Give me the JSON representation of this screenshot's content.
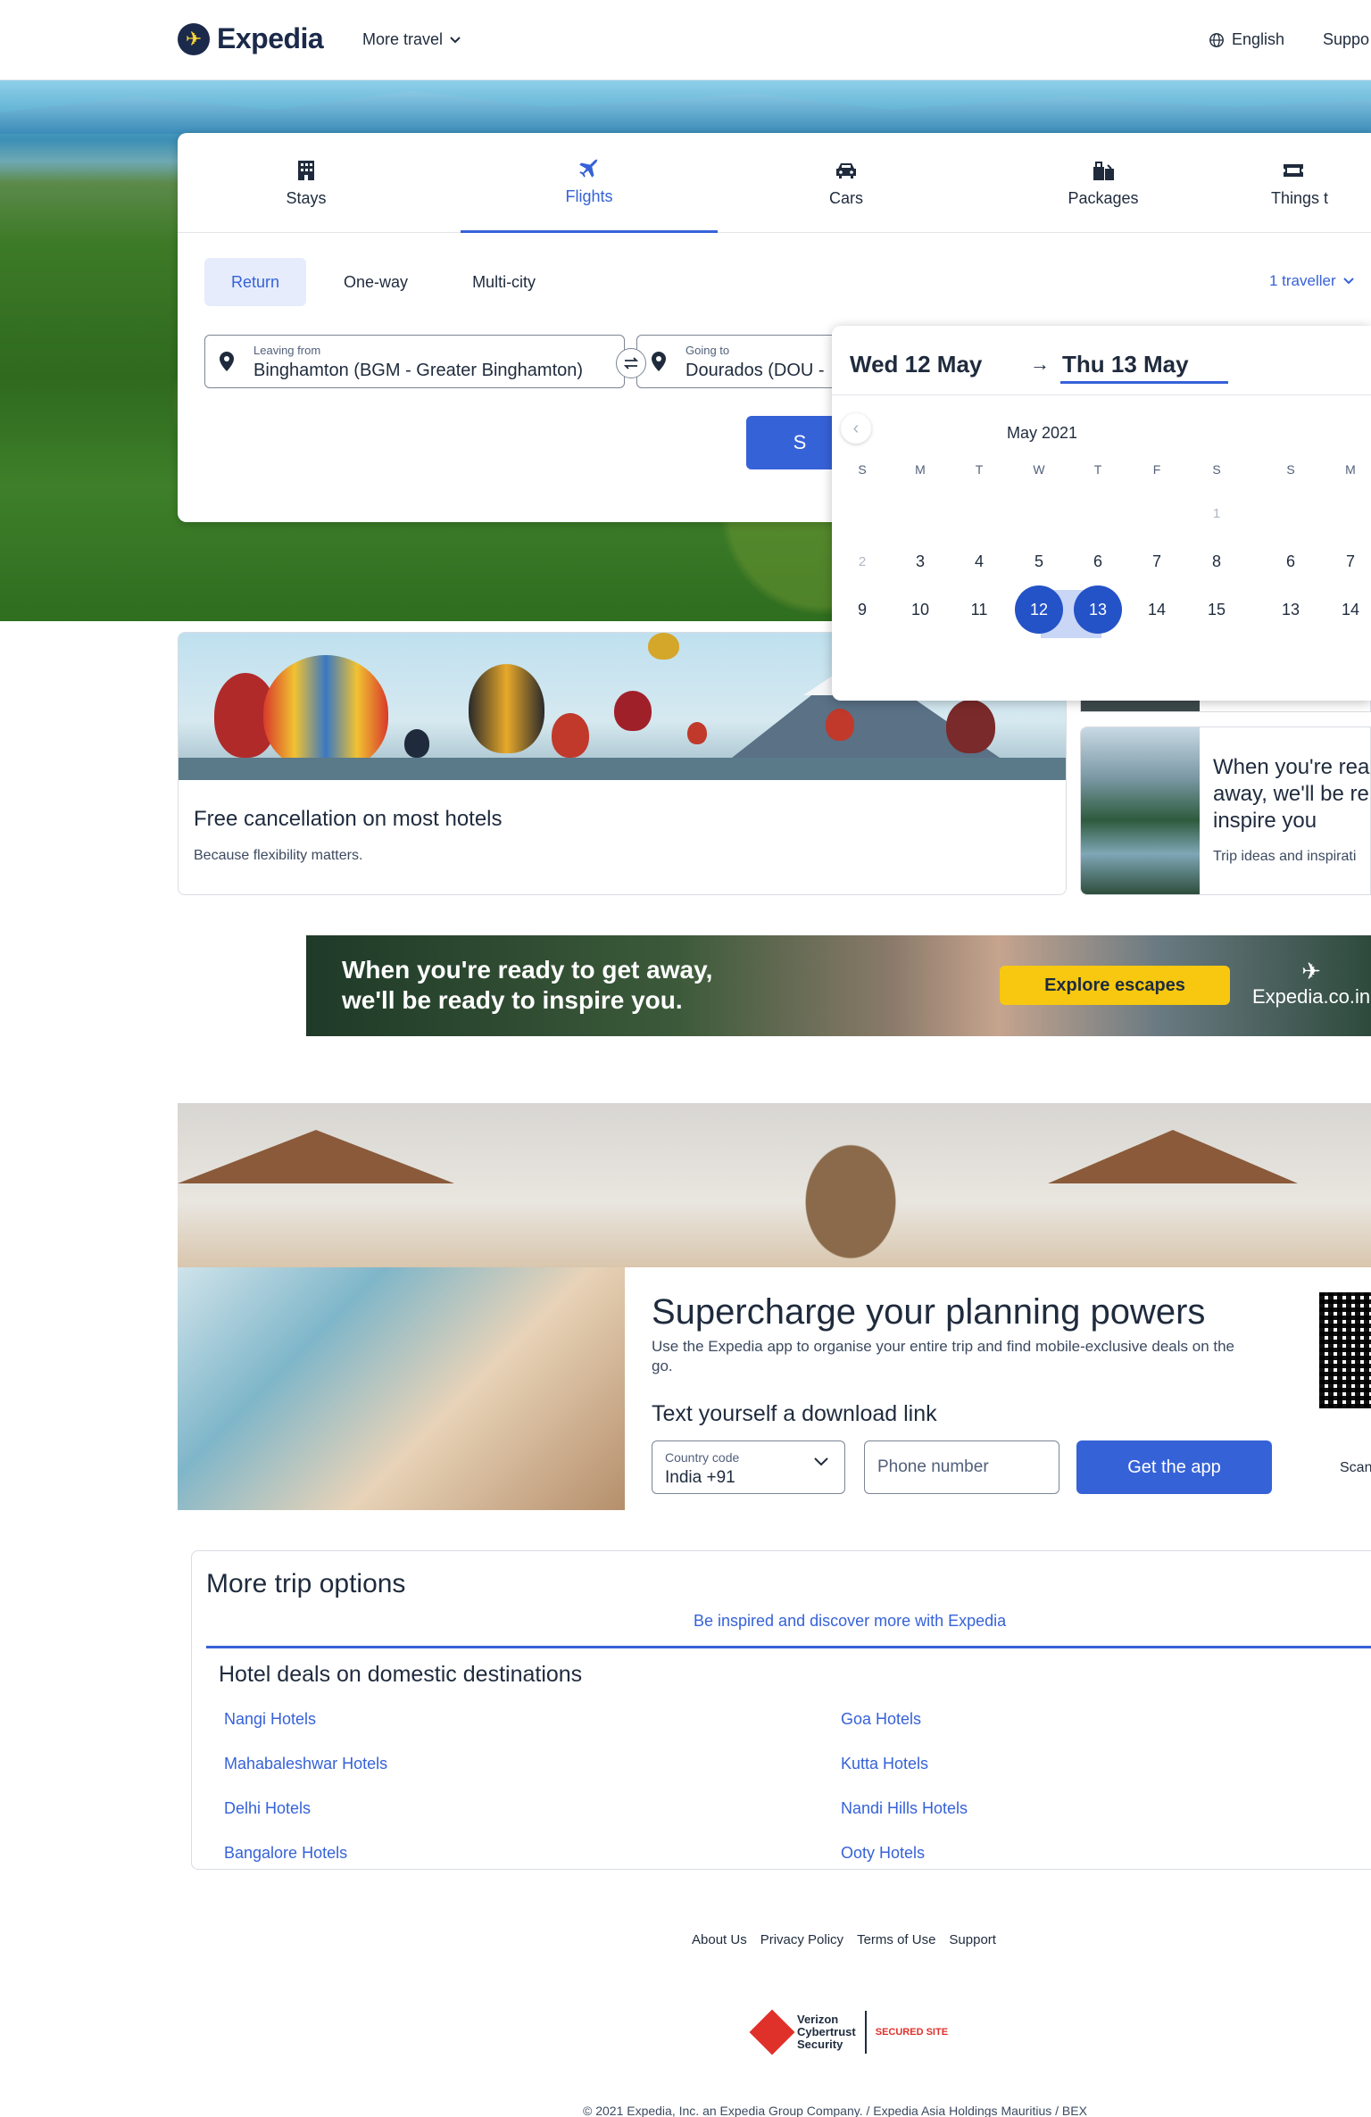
{
  "header": {
    "brand": "Expedia",
    "more_travel": "More travel",
    "language": "English",
    "support": "Suppo"
  },
  "search": {
    "tabs": [
      {
        "label": "Stays",
        "icon": "building-icon"
      },
      {
        "label": "Flights",
        "icon": "plane-icon",
        "active": true
      },
      {
        "label": "Cars",
        "icon": "car-icon"
      },
      {
        "label": "Packages",
        "icon": "packages-icon"
      },
      {
        "label": "Things t",
        "icon": "ticket-icon"
      }
    ],
    "trip_types": [
      "Return",
      "One-way",
      "Multi-city"
    ],
    "trip_type_selected": "Return",
    "travellers": "1 traveller",
    "leaving_label": "Leaving from",
    "leaving_value": "Binghamton (BGM - Greater Binghamton)",
    "going_label": "Going to",
    "going_value": "Dourados (DOU -",
    "search_button": "S"
  },
  "datepicker": {
    "start": "Wed 12 May",
    "end": "Thu 13 May",
    "month": "May 2021",
    "weekdays": [
      "S",
      "M",
      "T",
      "W",
      "T",
      "F",
      "S"
    ],
    "next_weekdays": [
      "S",
      "M"
    ],
    "rows": [
      [
        "",
        "",
        "",
        "",
        "",
        "",
        "1"
      ],
      [
        "2",
        "3",
        "4",
        "5",
        "6",
        "7",
        "8"
      ],
      [
        "9",
        "10",
        "11",
        "12",
        "13",
        "14",
        "15"
      ]
    ],
    "next_rows": [
      [
        "",
        ""
      ],
      [
        "6",
        "7"
      ],
      [
        "13",
        "14"
      ]
    ]
  },
  "cards": {
    "hotels_title": "Free cancellation on most hotels",
    "hotels_sub": "Because flexibility matters.",
    "inspire_title_1": "When you're rea",
    "inspire_title_2": "away, we'll be re",
    "inspire_title_3": "inspire you",
    "inspire_sub": "Trip ideas and inspirati"
  },
  "banner": {
    "line1": "When you're ready to get away,",
    "line2": "we'll be ready to inspire you.",
    "cta": "Explore escapes",
    "brand": "Expedia.co.in"
  },
  "app_promo": {
    "title": "Supercharge your planning powers",
    "subtitle": "Use the Expedia app to organise your entire trip and find mobile-exclusive deals on the go.",
    "download_heading": "Text yourself a download link",
    "country_label": "Country code",
    "country_value": "India +91",
    "phone_placeholder": "Phone number",
    "get_app": "Get the app",
    "scan": "Scan"
  },
  "more_trip": {
    "title": "More trip options",
    "tab": "Be inspired and discover more with Expedia",
    "section_title": "Hotel deals on domestic destinations",
    "left_links": [
      "Nangi Hotels",
      "Mahabaleshwar Hotels",
      "Delhi Hotels",
      "Bangalore Hotels"
    ],
    "right_links": [
      "Goa Hotels",
      "Kutta Hotels",
      "Nandi Hills Hotels",
      "Ooty Hotels"
    ]
  },
  "footer": {
    "links": [
      "About Us",
      "Privacy Policy",
      "Terms of Use",
      "Support"
    ],
    "cybertrust_1": "Verizon",
    "cybertrust_2": "Cybertrust",
    "cybertrust_3": "Security",
    "secured": "SECURED SITE",
    "copyright": "© 2021 Expedia, Inc. an Expedia Group Company. / Expedia Asia Holdings Mauritius / BEX"
  },
  "colors": {
    "accent": "#3662d8",
    "brand_navy": "#1b2a4a",
    "cta_yellow": "#f7c80f"
  }
}
